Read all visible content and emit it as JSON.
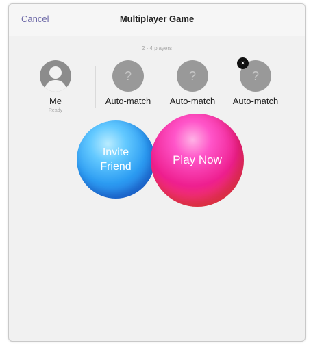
{
  "nav": {
    "cancel_label": "Cancel",
    "title": "Multiplayer Game"
  },
  "players_range": "2 - 4 players",
  "slots": [
    {
      "label": "Me",
      "status": "Ready",
      "icon": "person-silhouette-icon"
    },
    {
      "label": "Auto-match",
      "glyph": "?"
    },
    {
      "label": "Auto-match",
      "glyph": "?"
    },
    {
      "label": "Auto-match",
      "glyph": "?",
      "remove_glyph": "×"
    }
  ],
  "bubbles": {
    "invite_line1": "Invite",
    "invite_line2": "Friend",
    "play_now": "Play Now"
  },
  "colors": {
    "accent": "#6e6aa8",
    "invite_bubble": "#2c9cf2",
    "play_bubble": "#ee1f8f"
  }
}
